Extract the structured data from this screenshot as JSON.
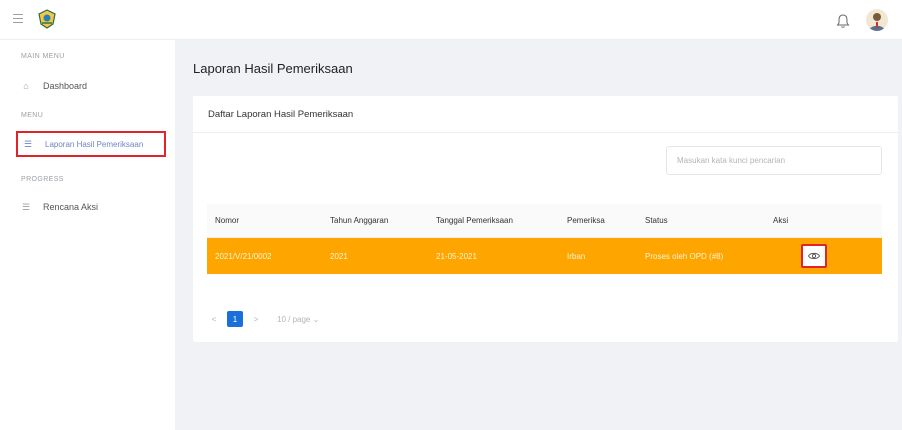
{
  "topbar": {
    "menu_icon": "hamburger-icon",
    "logo_icon": "emblem-logo",
    "notification_icon": "bell-icon",
    "avatar_icon": "user-avatar"
  },
  "sidebar": {
    "sections": [
      {
        "label": "MAIN MENU",
        "items": [
          {
            "label": "Dashboard",
            "icon": "home-icon"
          }
        ]
      },
      {
        "label": "MENU",
        "items": [
          {
            "label": "Laporan Hasil Pemeriksaan",
            "icon": "list-icon",
            "active": true
          }
        ]
      },
      {
        "label": "PROGRESS",
        "items": [
          {
            "label": "Rencana Aksi",
            "icon": "list-icon"
          }
        ]
      }
    ]
  },
  "main": {
    "page_title": "Laporan Hasil Pemeriksaan",
    "card_title": "Daftar Laporan Hasil Pemeriksaan",
    "search": {
      "placeholder": "Masukan kata kunci pencarian",
      "value": ""
    },
    "table": {
      "columns": [
        "Nomor",
        "Tahun Anggaran",
        "Tanggal Pemeriksaan",
        "Pemeriksa",
        "Status",
        "Aksi"
      ],
      "rows": [
        {
          "nomor": "2021/V/21/0002",
          "tahun": "2021",
          "tanggal": "21-05-2021",
          "pemeriksa": "Irban",
          "status": "Proses oleh OPD (#8)",
          "action_icon": "eye-icon"
        }
      ],
      "highlight_color": "#ffa500"
    },
    "pagination": {
      "prev": "<",
      "current_page": "1",
      "next": ">",
      "page_size": "10 / page",
      "active_color": "#1a6fd9"
    }
  },
  "accent": {
    "highlight_border": "#e0242a",
    "active_text": "#6e86c8"
  }
}
